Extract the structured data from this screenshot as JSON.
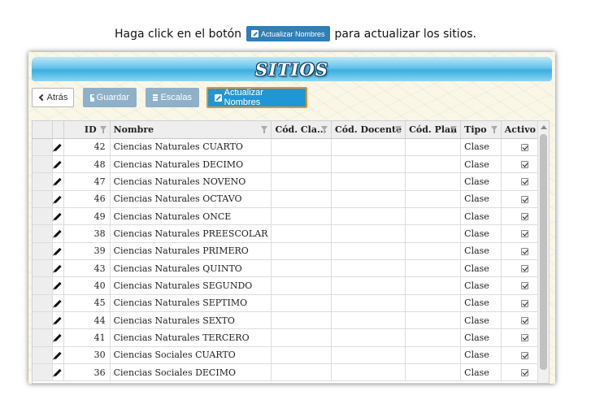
{
  "instruction": {
    "before": "Haga click en el botón",
    "button": "Actualizar Nombres",
    "after": "para actualizar los sitios."
  },
  "app": {
    "title": "SITIOS"
  },
  "toolbar": {
    "back_label": "Atrás",
    "save_label": "Guardar",
    "scales_label": "Escalas",
    "update_label": "Actualizar Nombres"
  },
  "grid": {
    "columns": [
      "ID",
      "Nombre",
      "Cód. Cla...",
      "Cód. Docente",
      "Cód. Plan",
      "Tipo",
      "Activo"
    ],
    "rows": [
      {
        "id": "42",
        "nombre": "Ciencias Naturales CUARTO",
        "tipo": "Clase",
        "activo": true
      },
      {
        "id": "48",
        "nombre": "Ciencias Naturales DECIMO",
        "tipo": "Clase",
        "activo": true
      },
      {
        "id": "47",
        "nombre": "Ciencias Naturales NOVENO",
        "tipo": "Clase",
        "activo": true
      },
      {
        "id": "46",
        "nombre": "Ciencias Naturales OCTAVO",
        "tipo": "Clase",
        "activo": true
      },
      {
        "id": "49",
        "nombre": "Ciencias Naturales ONCE",
        "tipo": "Clase",
        "activo": true
      },
      {
        "id": "38",
        "nombre": "Ciencias Naturales PREESCOLAR",
        "tipo": "Clase",
        "activo": true
      },
      {
        "id": "39",
        "nombre": "Ciencias Naturales PRIMERO",
        "tipo": "Clase",
        "activo": true
      },
      {
        "id": "43",
        "nombre": "Ciencias Naturales QUINTO",
        "tipo": "Clase",
        "activo": true
      },
      {
        "id": "40",
        "nombre": "Ciencias Naturales SEGUNDO",
        "tipo": "Clase",
        "activo": true
      },
      {
        "id": "45",
        "nombre": "Ciencias Naturales SEPTIMO",
        "tipo": "Clase",
        "activo": true
      },
      {
        "id": "44",
        "nombre": "Ciencias Naturales SEXTO",
        "tipo": "Clase",
        "activo": true
      },
      {
        "id": "41",
        "nombre": "Ciencias Naturales TERCERO",
        "tipo": "Clase",
        "activo": true
      },
      {
        "id": "30",
        "nombre": "Ciencias Sociales CUARTO",
        "tipo": "Clase",
        "activo": true
      },
      {
        "id": "36",
        "nombre": "Ciencias Sociales DECIMO",
        "tipo": "Clase",
        "activo": true
      }
    ]
  },
  "colors": {
    "accent": "#1f97d6",
    "highlight_border": "#e8902a",
    "gray_button": "#8fb0c9"
  },
  "icons": [
    "chevron-left-icon",
    "floppy-disk-icon",
    "list-icon",
    "pencil-icon",
    "filter-icon",
    "checkbox-checked-icon"
  ]
}
